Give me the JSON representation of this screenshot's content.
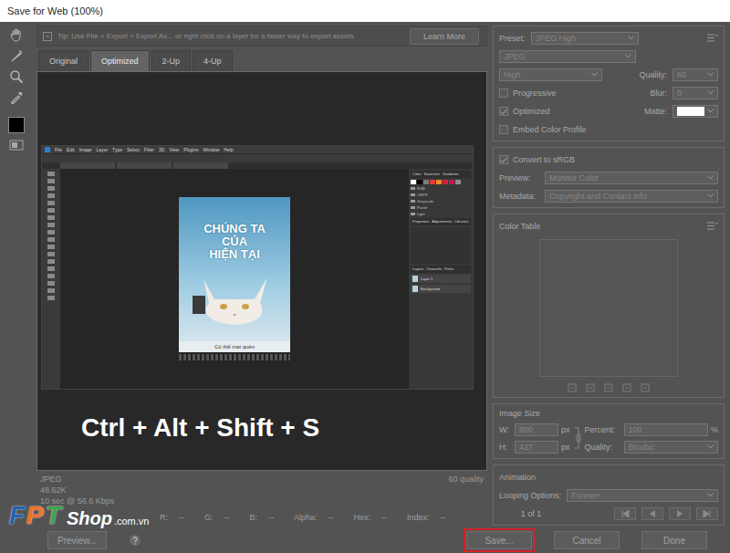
{
  "window": {
    "title": "Save for Web (100%)"
  },
  "tip": {
    "text": "Tip: Use File > Export > Export As... or right click on a layer for a faster way to export assets",
    "button": "Learn More"
  },
  "tabs": [
    {
      "label": "Original",
      "selected": false
    },
    {
      "label": "Optimized",
      "selected": true
    },
    {
      "label": "2-Up",
      "selected": false
    },
    {
      "label": "4-Up",
      "selected": false
    }
  ],
  "preview": {
    "caption": "Ctrl + Alt + Shift + S",
    "nested": {
      "menu": [
        "File",
        "Edit",
        "Image",
        "Layer",
        "Type",
        "Select",
        "Filter",
        "3D",
        "View",
        "Plugins",
        "Window",
        "Help"
      ],
      "poster": {
        "title_lines": [
          "CHÚNG TA",
          "CỦA",
          "HIỆN TẠI"
        ],
        "caption": "Có thể mai quên"
      },
      "panel_tabs": [
        "Color",
        "Swatches",
        "Gradients"
      ],
      "swatches": [
        {
          "color": "#ffffff"
        },
        {
          "color": "#000000"
        },
        {
          "color": "#7a7a7a"
        },
        {
          "color": "#e03c31"
        },
        {
          "color": "#f08a24"
        },
        {
          "color": "#d81f3a"
        },
        {
          "color": "#c2185b"
        },
        {
          "color": "#8e8e8e"
        }
      ],
      "folders": [
        "RGB",
        "CMYK",
        "Grayscale",
        "Pastel",
        "Light"
      ],
      "props_tabs": [
        "Properties",
        "Adjustments",
        "Libraries"
      ],
      "layers_tabs": [
        "Layers",
        "Channels",
        "Paths"
      ],
      "layers": [
        "Layer 1",
        "Background"
      ]
    }
  },
  "info": {
    "format": "JPEG",
    "size": "48.62K",
    "time": "10 sec @ 56.6 Kbps",
    "quality": "60 quality"
  },
  "readouts": [
    {
      "label": "R:",
      "value": "--"
    },
    {
      "label": "G:",
      "value": "--"
    },
    {
      "label": "B:",
      "value": "--"
    },
    {
      "label": "Alpha:",
      "value": "--"
    },
    {
      "label": "Hex:",
      "value": "--"
    },
    {
      "label": "Index:",
      "value": "--"
    }
  ],
  "settings": {
    "disabled": true,
    "preset": {
      "label": "Preset:",
      "value": "JPEG High"
    },
    "format": "JPEG",
    "compression": "High",
    "quality": {
      "label": "Quality:",
      "value": "60"
    },
    "progressive": {
      "label": "Progressive",
      "checked": false
    },
    "blur": {
      "label": "Blur:",
      "value": "0"
    },
    "optimized": {
      "label": "Optimized",
      "checked": true
    },
    "matte": {
      "label": "Matte:",
      "color": "#ffffff"
    },
    "embed_profile": {
      "label": "Embed Color Profile",
      "checked": false
    },
    "convert_srgb": {
      "label": "Convert to sRGB",
      "checked": true
    },
    "preview": {
      "label": "Preview:",
      "value": "Monitor Color"
    },
    "metadata": {
      "label": "Metadata:",
      "value": "Copyright and Contact Info"
    },
    "color_table": {
      "title": "Color Table"
    },
    "image_size": {
      "title": "Image Size",
      "w_label": "W:",
      "w": "800",
      "w_unit": "px",
      "h_label": "H:",
      "h": "427",
      "h_unit": "px",
      "percent_label": "Percent:",
      "percent": "100",
      "percent_unit": "%",
      "quality_label": "Quality:",
      "quality": "Bicubic"
    },
    "animation": {
      "title": "Animation",
      "looping_label": "Looping Options:",
      "looping": "Forever",
      "frame": "1 of 1"
    }
  },
  "bottom": {
    "preview_button": "Preview..."
  },
  "buttons": [
    {
      "label": "Save...",
      "highlighted": true
    },
    {
      "label": "Cancel",
      "highlighted": false
    },
    {
      "label": "Done",
      "highlighted": false
    }
  ],
  "watermark": {
    "letters": [
      {
        "text": "F",
        "color": "#1f64b3"
      },
      {
        "text": "P",
        "color": "#f37021"
      },
      {
        "text": "T",
        "color": "#3aa54a"
      }
    ],
    "shop": "Shop",
    "domain": ".com.vn"
  }
}
